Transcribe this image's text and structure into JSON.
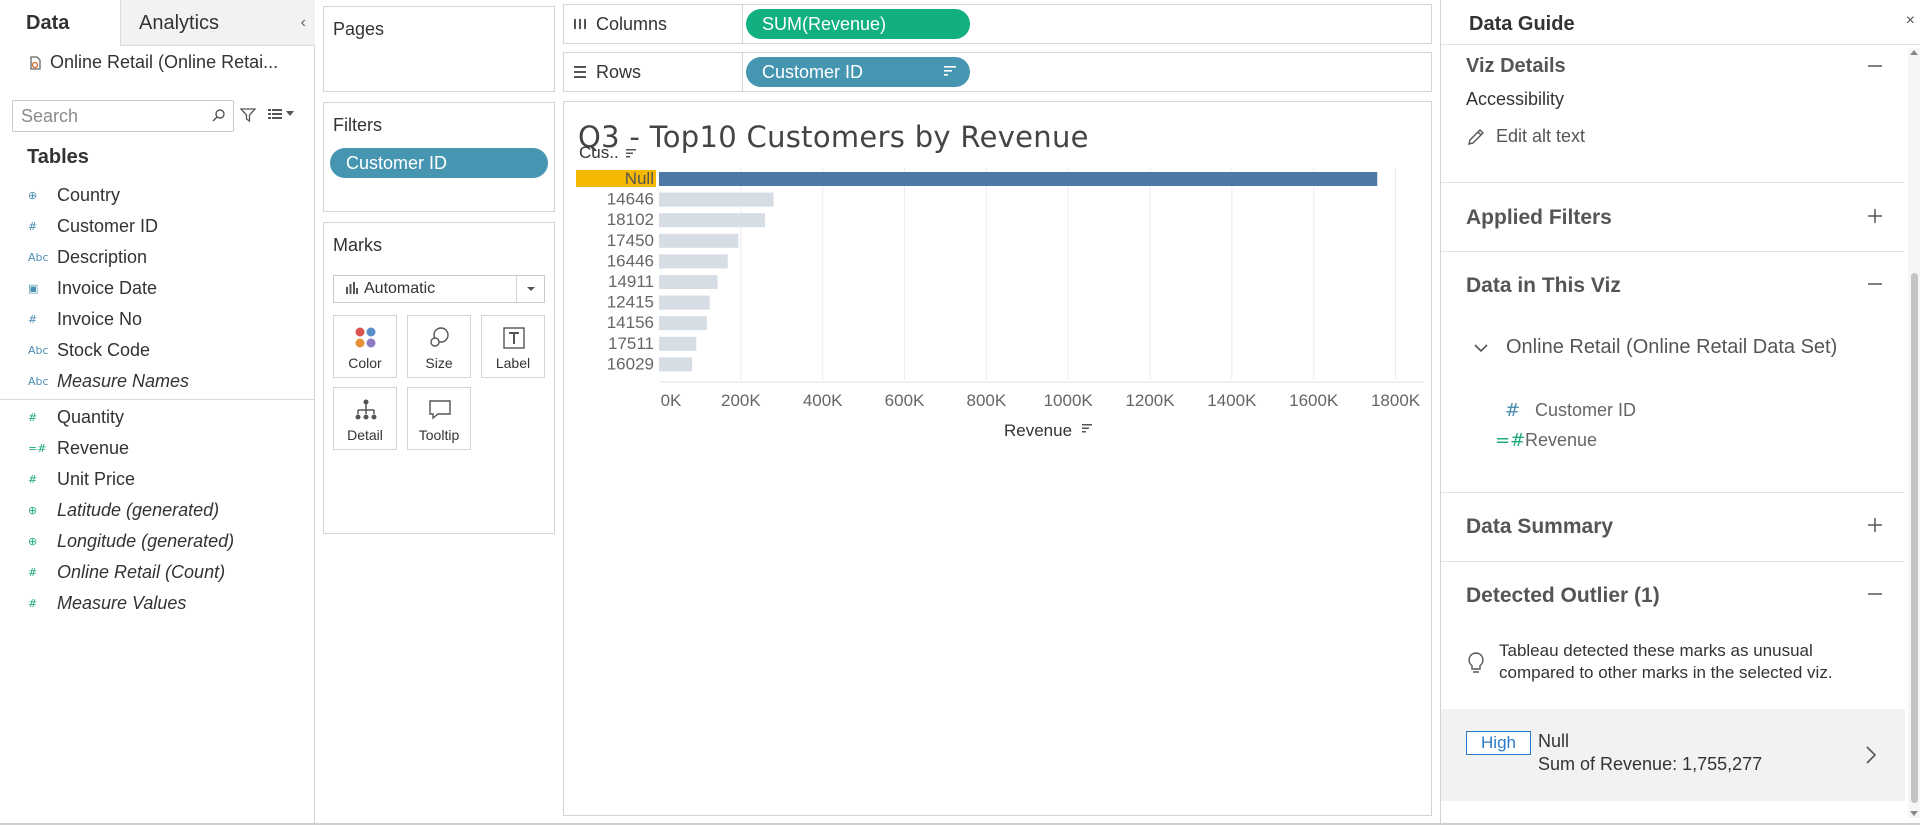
{
  "left_pane": {
    "tabs": [
      "Data",
      "Analytics"
    ],
    "datasource": "Online Retail (Online Retai...",
    "search_placeholder": "Search",
    "tables_label": "Tables",
    "dimensions": [
      {
        "icon": "⊕",
        "name": "Country",
        "italic": false,
        "kind": "geo"
      },
      {
        "icon": "#",
        "name": "Customer ID",
        "italic": false,
        "kind": "dim"
      },
      {
        "icon": "Abc",
        "name": "Description",
        "italic": false,
        "kind": "dim"
      },
      {
        "icon": "▣",
        "name": "Invoice Date",
        "italic": false,
        "kind": "dim"
      },
      {
        "icon": "#",
        "name": "Invoice No",
        "italic": false,
        "kind": "dim"
      },
      {
        "icon": "Abc",
        "name": "Stock Code",
        "italic": false,
        "kind": "dim"
      },
      {
        "icon": "Abc",
        "name": "Measure Names",
        "italic": true,
        "kind": "dim"
      }
    ],
    "measures": [
      {
        "icon": "#",
        "name": "Quantity",
        "italic": false,
        "kind": "meas"
      },
      {
        "icon": "=#",
        "name": "Revenue",
        "italic": false,
        "kind": "meas"
      },
      {
        "icon": "#",
        "name": "Unit Price",
        "italic": false,
        "kind": "meas"
      },
      {
        "icon": "⊕",
        "name": "Latitude (generated)",
        "italic": true,
        "kind": "meas"
      },
      {
        "icon": "⊕",
        "name": "Longitude (generated)",
        "italic": true,
        "kind": "meas"
      },
      {
        "icon": "#",
        "name": "Online Retail (Count)",
        "italic": true,
        "kind": "meas"
      },
      {
        "icon": "#",
        "name": "Measure Values",
        "italic": true,
        "kind": "meas"
      }
    ]
  },
  "pages": {
    "title": "Pages"
  },
  "filters": {
    "title": "Filters",
    "pill": "Customer ID"
  },
  "marks": {
    "title": "Marks",
    "type": "Automatic",
    "buttons": [
      "Color",
      "Size",
      "Label",
      "Detail",
      "Tooltip"
    ]
  },
  "columns": {
    "label": "Columns",
    "pill": "SUM(Revenue)"
  },
  "rows": {
    "label": "Rows",
    "pill": "Customer ID"
  },
  "viz": {
    "title": "Q3 - Top10 Customers by Revenue"
  },
  "chart_data": {
    "type": "bar",
    "orientation": "horizontal",
    "title": "Q3 - Top10 Customers by Revenue",
    "row_header": "Cus..",
    "xlabel": "Revenue",
    "categories": [
      "Null",
      "14646",
      "18102",
      "17450",
      "16446",
      "14911",
      "12415",
      "14156",
      "17511",
      "16029"
    ],
    "values": [
      1755277,
      280000,
      259000,
      194000,
      168000,
      143000,
      124000,
      117000,
      91000,
      81000
    ],
    "xlim": [
      0,
      1850000
    ],
    "xticks": [
      0,
      200000,
      400000,
      600000,
      800000,
      1000000,
      1200000,
      1400000,
      1600000,
      1800000
    ],
    "xtick_labels": [
      "0K",
      "200K",
      "400K",
      "600K",
      "800K",
      "1000K",
      "1200K",
      "1400K",
      "1600K",
      "1800K"
    ],
    "highlight_category": "Null",
    "colors": {
      "highlight_bar": "#4e79a7",
      "dim_bar": "#d6dde5",
      "highlight_label_bg": "#f5b800",
      "grid": "#ececec"
    },
    "grid": true
  },
  "guide": {
    "title": "Data Guide",
    "viz_details": "Viz Details",
    "accessibility": "Accessibility",
    "edit_alt_text": "Edit alt text",
    "applied_filters": "Applied Filters",
    "data_in_viz": "Data in This Viz",
    "datasource": "Online Retail (Online Retail Data Set)",
    "fields": [
      "Customer ID",
      "Revenue"
    ],
    "data_summary": "Data Summary",
    "detected_outlier": "Detected Outlier (1)",
    "outlier_desc_1": "Tableau detected these marks as unusual",
    "outlier_desc_2": "compared to other marks in the selected viz.",
    "badge": "High",
    "outlier_name": "Null",
    "outlier_value": "Sum of Revenue: 1,755,277"
  },
  "colors": {
    "dimension_pill": "#4796b1",
    "measure_pill": "#12b080",
    "badge_blue": "#2b7bc8"
  }
}
